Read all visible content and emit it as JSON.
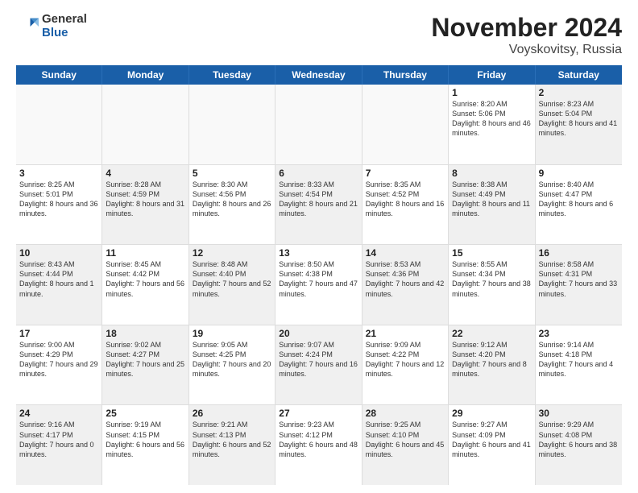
{
  "logo": {
    "general": "General",
    "blue": "Blue"
  },
  "title": {
    "month": "November 2024",
    "location": "Voyskovitsy, Russia"
  },
  "header_days": [
    "Sunday",
    "Monday",
    "Tuesday",
    "Wednesday",
    "Thursday",
    "Friday",
    "Saturday"
  ],
  "rows": [
    [
      {
        "day": "",
        "info": "",
        "empty": true
      },
      {
        "day": "",
        "info": "",
        "empty": true
      },
      {
        "day": "",
        "info": "",
        "empty": true
      },
      {
        "day": "",
        "info": "",
        "empty": true
      },
      {
        "day": "",
        "info": "",
        "empty": true
      },
      {
        "day": "1",
        "info": "Sunrise: 8:20 AM\nSunset: 5:06 PM\nDaylight: 8 hours and 46 minutes.",
        "empty": false,
        "shaded": false
      },
      {
        "day": "2",
        "info": "Sunrise: 8:23 AM\nSunset: 5:04 PM\nDaylight: 8 hours and 41 minutes.",
        "empty": false,
        "shaded": true
      }
    ],
    [
      {
        "day": "3",
        "info": "Sunrise: 8:25 AM\nSunset: 5:01 PM\nDaylight: 8 hours and 36 minutes.",
        "empty": false,
        "shaded": false
      },
      {
        "day": "4",
        "info": "Sunrise: 8:28 AM\nSunset: 4:59 PM\nDaylight: 8 hours and 31 minutes.",
        "empty": false,
        "shaded": true
      },
      {
        "day": "5",
        "info": "Sunrise: 8:30 AM\nSunset: 4:56 PM\nDaylight: 8 hours and 26 minutes.",
        "empty": false,
        "shaded": false
      },
      {
        "day": "6",
        "info": "Sunrise: 8:33 AM\nSunset: 4:54 PM\nDaylight: 8 hours and 21 minutes.",
        "empty": false,
        "shaded": true
      },
      {
        "day": "7",
        "info": "Sunrise: 8:35 AM\nSunset: 4:52 PM\nDaylight: 8 hours and 16 minutes.",
        "empty": false,
        "shaded": false
      },
      {
        "day": "8",
        "info": "Sunrise: 8:38 AM\nSunset: 4:49 PM\nDaylight: 8 hours and 11 minutes.",
        "empty": false,
        "shaded": true
      },
      {
        "day": "9",
        "info": "Sunrise: 8:40 AM\nSunset: 4:47 PM\nDaylight: 8 hours and 6 minutes.",
        "empty": false,
        "shaded": false
      }
    ],
    [
      {
        "day": "10",
        "info": "Sunrise: 8:43 AM\nSunset: 4:44 PM\nDaylight: 8 hours and 1 minute.",
        "empty": false,
        "shaded": true
      },
      {
        "day": "11",
        "info": "Sunrise: 8:45 AM\nSunset: 4:42 PM\nDaylight: 7 hours and 56 minutes.",
        "empty": false,
        "shaded": false
      },
      {
        "day": "12",
        "info": "Sunrise: 8:48 AM\nSunset: 4:40 PM\nDaylight: 7 hours and 52 minutes.",
        "empty": false,
        "shaded": true
      },
      {
        "day": "13",
        "info": "Sunrise: 8:50 AM\nSunset: 4:38 PM\nDaylight: 7 hours and 47 minutes.",
        "empty": false,
        "shaded": false
      },
      {
        "day": "14",
        "info": "Sunrise: 8:53 AM\nSunset: 4:36 PM\nDaylight: 7 hours and 42 minutes.",
        "empty": false,
        "shaded": true
      },
      {
        "day": "15",
        "info": "Sunrise: 8:55 AM\nSunset: 4:34 PM\nDaylight: 7 hours and 38 minutes.",
        "empty": false,
        "shaded": false
      },
      {
        "day": "16",
        "info": "Sunrise: 8:58 AM\nSunset: 4:31 PM\nDaylight: 7 hours and 33 minutes.",
        "empty": false,
        "shaded": true
      }
    ],
    [
      {
        "day": "17",
        "info": "Sunrise: 9:00 AM\nSunset: 4:29 PM\nDaylight: 7 hours and 29 minutes.",
        "empty": false,
        "shaded": false
      },
      {
        "day": "18",
        "info": "Sunrise: 9:02 AM\nSunset: 4:27 PM\nDaylight: 7 hours and 25 minutes.",
        "empty": false,
        "shaded": true
      },
      {
        "day": "19",
        "info": "Sunrise: 9:05 AM\nSunset: 4:25 PM\nDaylight: 7 hours and 20 minutes.",
        "empty": false,
        "shaded": false
      },
      {
        "day": "20",
        "info": "Sunrise: 9:07 AM\nSunset: 4:24 PM\nDaylight: 7 hours and 16 minutes.",
        "empty": false,
        "shaded": true
      },
      {
        "day": "21",
        "info": "Sunrise: 9:09 AM\nSunset: 4:22 PM\nDaylight: 7 hours and 12 minutes.",
        "empty": false,
        "shaded": false
      },
      {
        "day": "22",
        "info": "Sunrise: 9:12 AM\nSunset: 4:20 PM\nDaylight: 7 hours and 8 minutes.",
        "empty": false,
        "shaded": true
      },
      {
        "day": "23",
        "info": "Sunrise: 9:14 AM\nSunset: 4:18 PM\nDaylight: 7 hours and 4 minutes.",
        "empty": false,
        "shaded": false
      }
    ],
    [
      {
        "day": "24",
        "info": "Sunrise: 9:16 AM\nSunset: 4:17 PM\nDaylight: 7 hours and 0 minutes.",
        "empty": false,
        "shaded": true
      },
      {
        "day": "25",
        "info": "Sunrise: 9:19 AM\nSunset: 4:15 PM\nDaylight: 6 hours and 56 minutes.",
        "empty": false,
        "shaded": false
      },
      {
        "day": "26",
        "info": "Sunrise: 9:21 AM\nSunset: 4:13 PM\nDaylight: 6 hours and 52 minutes.",
        "empty": false,
        "shaded": true
      },
      {
        "day": "27",
        "info": "Sunrise: 9:23 AM\nSunset: 4:12 PM\nDaylight: 6 hours and 48 minutes.",
        "empty": false,
        "shaded": false
      },
      {
        "day": "28",
        "info": "Sunrise: 9:25 AM\nSunset: 4:10 PM\nDaylight: 6 hours and 45 minutes.",
        "empty": false,
        "shaded": true
      },
      {
        "day": "29",
        "info": "Sunrise: 9:27 AM\nSunset: 4:09 PM\nDaylight: 6 hours and 41 minutes.",
        "empty": false,
        "shaded": false
      },
      {
        "day": "30",
        "info": "Sunrise: 9:29 AM\nSunset: 4:08 PM\nDaylight: 6 hours and 38 minutes.",
        "empty": false,
        "shaded": true
      }
    ]
  ]
}
